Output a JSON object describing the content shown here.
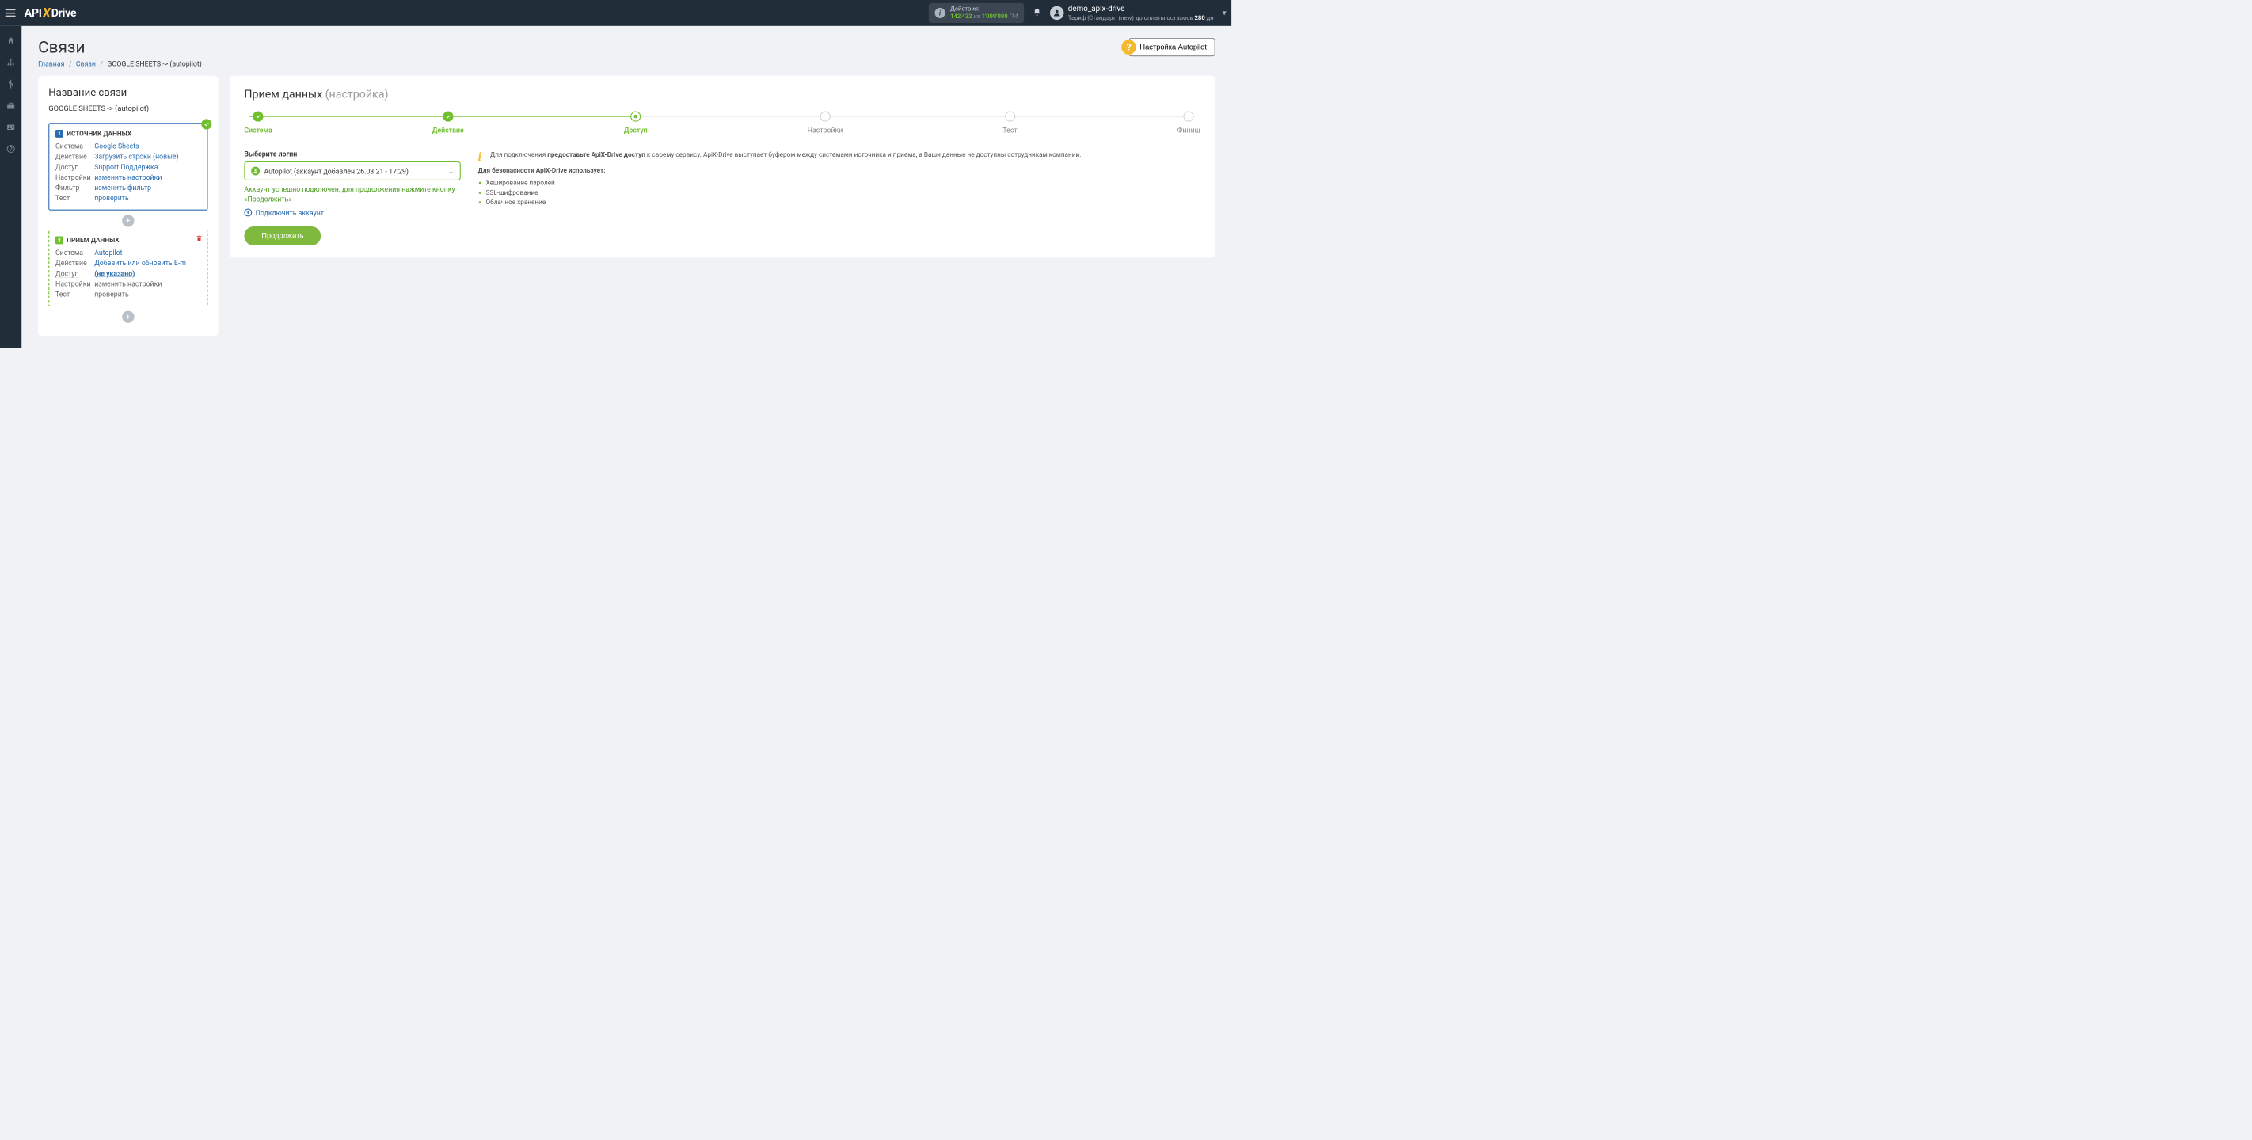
{
  "topbar": {
    "actions_label": "Действия:",
    "actions_used": "142'432",
    "actions_of": "из",
    "actions_total": "1'000'000",
    "actions_pct": "(14",
    "user_name": "demo_apix-drive",
    "plan_prefix": "Тариф |Стандарт| (new) до оплаты осталось ",
    "plan_days": "280",
    "plan_suffix": " дн"
  },
  "page": {
    "title": "Связи",
    "breadcrumb_home": "Главная",
    "breadcrumb_links": "Связи",
    "breadcrumb_current": "GOOGLE SHEETS -> (autopilot)",
    "autopilot_btn": "Настройка Autopilot"
  },
  "left": {
    "title": "Название связи",
    "conn_name": "GOOGLE SHEETS -> (autopilot)",
    "source": {
      "heading": "ИСТОЧНИК ДАННЫХ",
      "rows": {
        "system_l": "Система",
        "system_v": "Google Sheets",
        "action_l": "Действие",
        "action_v": "Загрузить строки (новые)",
        "access_l": "Доступ",
        "access_v": "Support Поддержка",
        "settings_l": "Настройки",
        "settings_v": "изменить настройки",
        "filter_l": "Фильтр",
        "filter_v": "изменить фильтр",
        "test_l": "Тест",
        "test_v": "проверить"
      }
    },
    "dest": {
      "heading": "ПРИЕМ ДАННЫХ",
      "rows": {
        "system_l": "Система",
        "system_v": "Autopilot",
        "action_l": "Действие",
        "action_v": "Добавить или обновить E-m",
        "access_l": "Доступ",
        "access_v": "(не указано)",
        "settings_l": "Настройки",
        "settings_v": "изменить настройки",
        "test_l": "Тест",
        "test_v": "проверить"
      }
    }
  },
  "right": {
    "title_main": "Прием данных",
    "title_sub": "(настройка)",
    "steps": {
      "s1": "Система",
      "s2": "Действие",
      "s3": "Доступ",
      "s4": "Настройки",
      "s5": "Тест",
      "s6": "Финиш"
    },
    "form": {
      "label": "Выберите логин",
      "selected": "Autopilot (аккаунт добавлен 26.03.21 - 17:29)",
      "success": "Аккаунт успешно подключен, для продолжения нажмите кнопку «Продолжить»",
      "connect": "Подключить аккаунт",
      "continue": "Продолжить"
    },
    "info": {
      "p1a": "Для подключения ",
      "p1b": "предоставьте ApiX-Drive доступ",
      "p1c": " к своему сервису. ApiX-Drive выступает буфером между системами источника и приема, а Ваши данные не доступны сотрудникам компании.",
      "sec_title": "Для безопасности ApiX-Drive использует:",
      "li1": "Хеширование паролей",
      "li2": "SSL-шифрование",
      "li3": "Облачное хранение"
    }
  }
}
